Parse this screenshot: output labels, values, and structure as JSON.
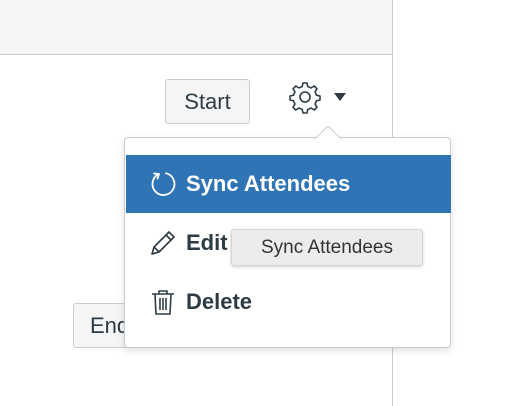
{
  "toolbar": {
    "start_label": "Start",
    "end_label": "End",
    "settings_icon": "gear-icon",
    "dropdown_icon": "caret-down-icon"
  },
  "menu": {
    "items": [
      {
        "label": "Sync Attendees",
        "icon": "refresh-icon",
        "highlighted": true
      },
      {
        "label": "Edit",
        "icon": "pencil-icon",
        "highlighted": false
      },
      {
        "label": "Delete",
        "icon": "trash-icon",
        "highlighted": false
      }
    ]
  },
  "tooltip": {
    "text": "Sync Attendees"
  },
  "colors": {
    "highlight": "#2f74b5",
    "text": "#2d3b45",
    "border": "#c7cdd1"
  }
}
